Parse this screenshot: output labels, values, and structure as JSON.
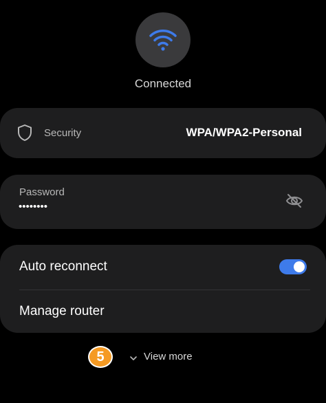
{
  "wifi": {
    "status": "Connected",
    "icon": "wifi-icon",
    "accent": "#3e7bea"
  },
  "security": {
    "label": "Security",
    "value": "WPA/WPA2-Personal",
    "icon": "shield-icon"
  },
  "password": {
    "label": "Password",
    "masked_value": "••••••••",
    "visibility_icon": "eye-off-icon"
  },
  "settings": {
    "auto_reconnect_label": "Auto reconnect",
    "auto_reconnect_enabled": true,
    "manage_router_label": "Manage router"
  },
  "footer": {
    "step_badge": "5",
    "view_more_label": "View more",
    "chevron_icon": "chevron-down-icon",
    "badge_color": "#f59a23"
  }
}
